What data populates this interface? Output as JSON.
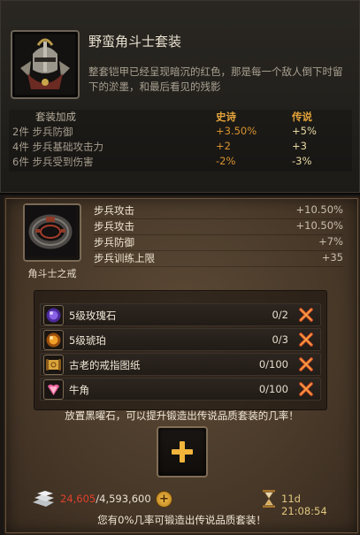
{
  "set": {
    "title": "野蛮角斗士套装",
    "description": "整套铠甲已经呈现暗沉的红色，那是每一个敌人倒下时留下的淤墨，和最后看见的残影",
    "icon": "helmet-icon",
    "bonus_header": {
      "label": "套装加成",
      "col1": "史诗",
      "col2": "传说"
    },
    "bonuses": [
      {
        "label": "2件 步兵防御",
        "col1": "+3.50%",
        "col2": "+5%"
      },
      {
        "label": "4件 步兵基础攻击力",
        "col1": "+2",
        "col2": "+3"
      },
      {
        "label": "6件 步兵受到伤害",
        "col1": "-2%",
        "col2": "-3%"
      }
    ]
  },
  "item": {
    "name": "角斗士之戒",
    "icon": "ring-icon",
    "stats": [
      {
        "name": "步兵攻击",
        "value": "+10.50%"
      },
      {
        "name": "步兵攻击",
        "value": "+10.50%"
      },
      {
        "name": "步兵防御",
        "value": "+7%"
      },
      {
        "name": "步兵训练上限",
        "value": "+35"
      }
    ]
  },
  "materials": [
    {
      "name": "5级玫瑰石",
      "count": "0/2",
      "icon": "rose-stone-icon",
      "color": "#6a3fc8"
    },
    {
      "name": "5级琥珀",
      "count": "0/3",
      "icon": "amber-icon",
      "color": "#e08a1c"
    },
    {
      "name": "古老的戒指图纸",
      "count": "0/100",
      "icon": "blueprint-scroll-icon",
      "color": "#d9a43a"
    },
    {
      "name": "牛角",
      "count": "0/100",
      "icon": "horn-icon",
      "color": "#e8609a"
    }
  ],
  "hint_top": "放置黑曜石，可以提升锻造出传说品质套装的几率！",
  "silver": {
    "current": "24,605",
    "max": "/4,593,600"
  },
  "timer": "11d 21:08:54",
  "hint_bottom": "您有0%几率可锻造出传说品质套装！"
}
